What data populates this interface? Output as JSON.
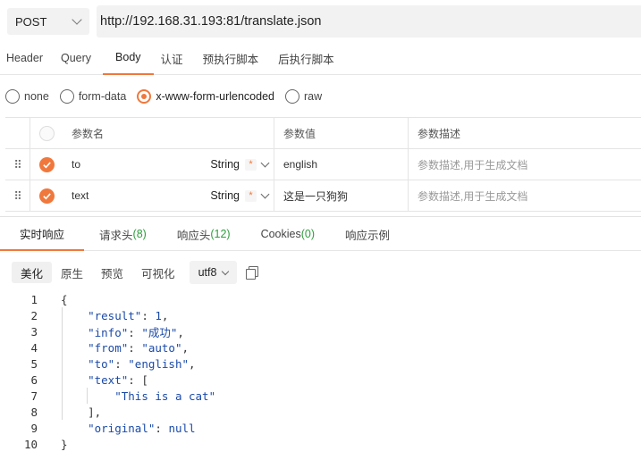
{
  "request": {
    "method": "POST",
    "url": "http://192.168.31.193:81/translate.json"
  },
  "req_tabs": [
    "Header",
    "Query",
    "Body",
    "认证",
    "预执行脚本",
    "后执行脚本"
  ],
  "body_types": [
    "none",
    "form-data",
    "x-www-form-urlencoded",
    "raw"
  ],
  "params": {
    "headers": {
      "name": "参数名",
      "value": "参数值",
      "desc": "参数描述"
    },
    "rows": [
      {
        "name": "to",
        "type": "String",
        "required_mark": "*",
        "value": "english",
        "desc_placeholder": "参数描述,用于生成文档"
      },
      {
        "name": "text",
        "type": "String",
        "required_mark": "*",
        "value": "这是一只狗狗",
        "desc_placeholder": "参数描述,用于生成文档"
      }
    ]
  },
  "response": {
    "tabs": {
      "live": "实时响应",
      "req_headers": "请求头",
      "req_headers_count": "(8)",
      "resp_headers": "响应头",
      "resp_headers_count": "(12)",
      "cookies": "Cookies",
      "cookies_count": "(0)",
      "example": "响应示例"
    },
    "views": [
      "美化",
      "原生",
      "预览",
      "可视化"
    ],
    "encoding": "utf8",
    "line_numbers": [
      "1",
      "2",
      "3",
      "4",
      "5",
      "6",
      "7",
      "8",
      "9",
      "10"
    ],
    "json": {
      "open": "{",
      "result_key": "\"result\"",
      "result_val": "1",
      "info_key": "\"info\"",
      "info_val": "\"成功\"",
      "from_key": "\"from\"",
      "from_val": "\"auto\"",
      "to_key": "\"to\"",
      "to_val": "\"english\"",
      "text_key": "\"text\"",
      "text_open": "[",
      "text_item": "\"This is a cat\"",
      "text_close": "],",
      "original_key": "\"original\"",
      "original_val": "null",
      "close": "}"
    }
  },
  "colors": {
    "accent": "#f0783c",
    "count_green": "#2e9d3c",
    "code_blue": "#1a4aa8"
  }
}
